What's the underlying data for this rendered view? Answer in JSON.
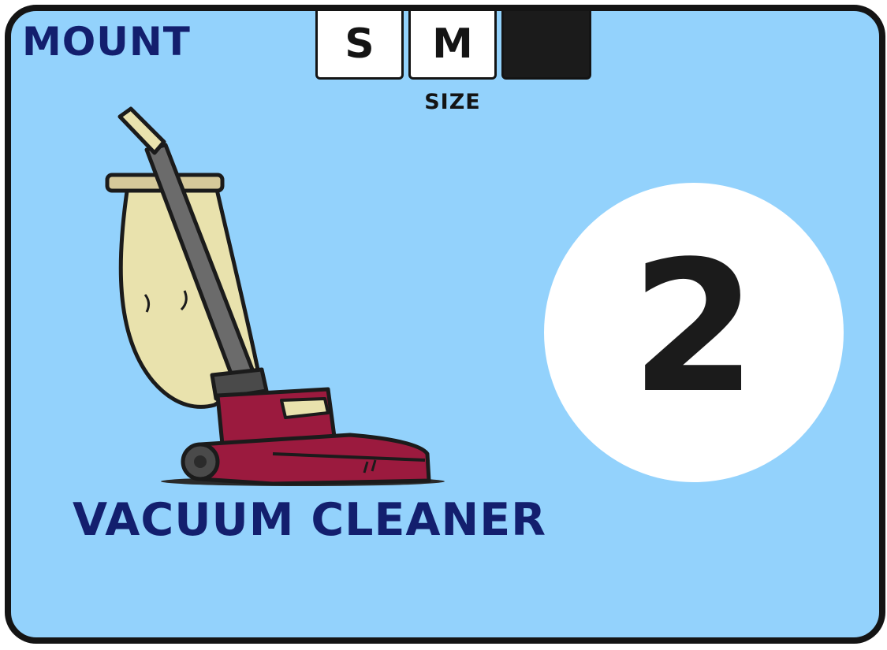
{
  "card": {
    "category": "MOUNT",
    "size_label": "SIZE",
    "sizes": [
      {
        "label": "S"
      },
      {
        "label": "M"
      },
      {
        "label": ""
      }
    ],
    "item_name": "VACUUM CLEANER",
    "value": "2",
    "icon": "vacuum-cleaner-icon",
    "colors": {
      "background": "#93d2fc",
      "border": "#141414",
      "title_text": "#131f6e",
      "body_red": "#9b1a3e",
      "bag": "#e9e2ad"
    }
  }
}
